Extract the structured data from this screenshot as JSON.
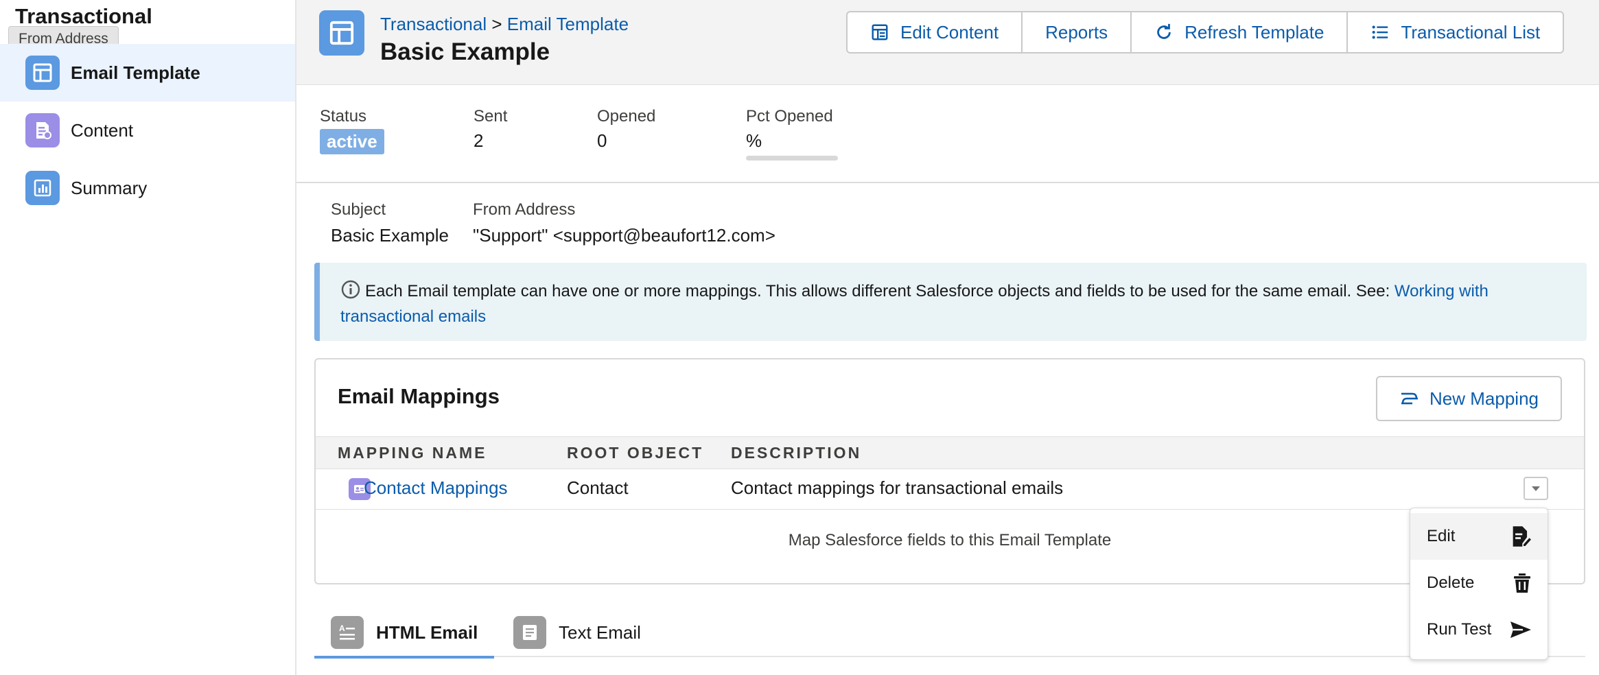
{
  "sidebar": {
    "app_title": "Transactional",
    "tooltip": "From Address",
    "items": [
      {
        "label": "Email Template",
        "icon": "template-icon",
        "color": "#5b99e0"
      },
      {
        "label": "Content",
        "icon": "content-icon",
        "color": "#9b8ee6"
      },
      {
        "label": "Summary",
        "icon": "chart-icon",
        "color": "#5b99e0"
      }
    ]
  },
  "header": {
    "breadcrumb": {
      "parent": "Transactional",
      "separator": ">",
      "current": "Email Template"
    },
    "title": "Basic Example",
    "buttons": {
      "edit_content": "Edit Content",
      "reports": "Reports",
      "refresh_template": "Refresh Template",
      "transactional_list": "Transactional List"
    }
  },
  "stats": {
    "status": {
      "label": "Status",
      "value": "active"
    },
    "sent": {
      "label": "Sent",
      "value": "2"
    },
    "opened": {
      "label": "Opened",
      "value": "0"
    },
    "pct_opened": {
      "label": "Pct Opened",
      "value": "%",
      "fraction": 0
    }
  },
  "details": {
    "subject": {
      "label": "Subject",
      "value": "Basic Example"
    },
    "from_address": {
      "label": "From Address",
      "value": "\"Support\" <support@beaufort12.com>"
    }
  },
  "banner": {
    "text": "Each Email template can have one or more mappings. This allows different Salesforce objects and fields to be used for the same email. See: ",
    "link_text": "Working with transactional emails"
  },
  "mappings": {
    "title": "Email Mappings",
    "new_button": "New Mapping",
    "columns": [
      "MAPPING NAME",
      "ROOT OBJECT",
      "DESCRIPTION"
    ],
    "rows": [
      {
        "name": "Contact Mappings",
        "root_object": "Contact",
        "description": "Contact mappings for transactional emails"
      }
    ],
    "footer": "Map Salesforce fields to this Email Template"
  },
  "row_menu": {
    "items": [
      {
        "label": "Edit",
        "icon": "edit-document-icon"
      },
      {
        "label": "Delete",
        "icon": "trash-icon"
      },
      {
        "label": "Run Test",
        "icon": "send-icon"
      }
    ]
  },
  "tabs": [
    {
      "label": "HTML Email",
      "active": true
    },
    {
      "label": "Text Email",
      "active": false
    }
  ],
  "colors": {
    "accent": "#5b99e0",
    "link": "#0b5cab",
    "status_badge": "#7eaee4"
  }
}
